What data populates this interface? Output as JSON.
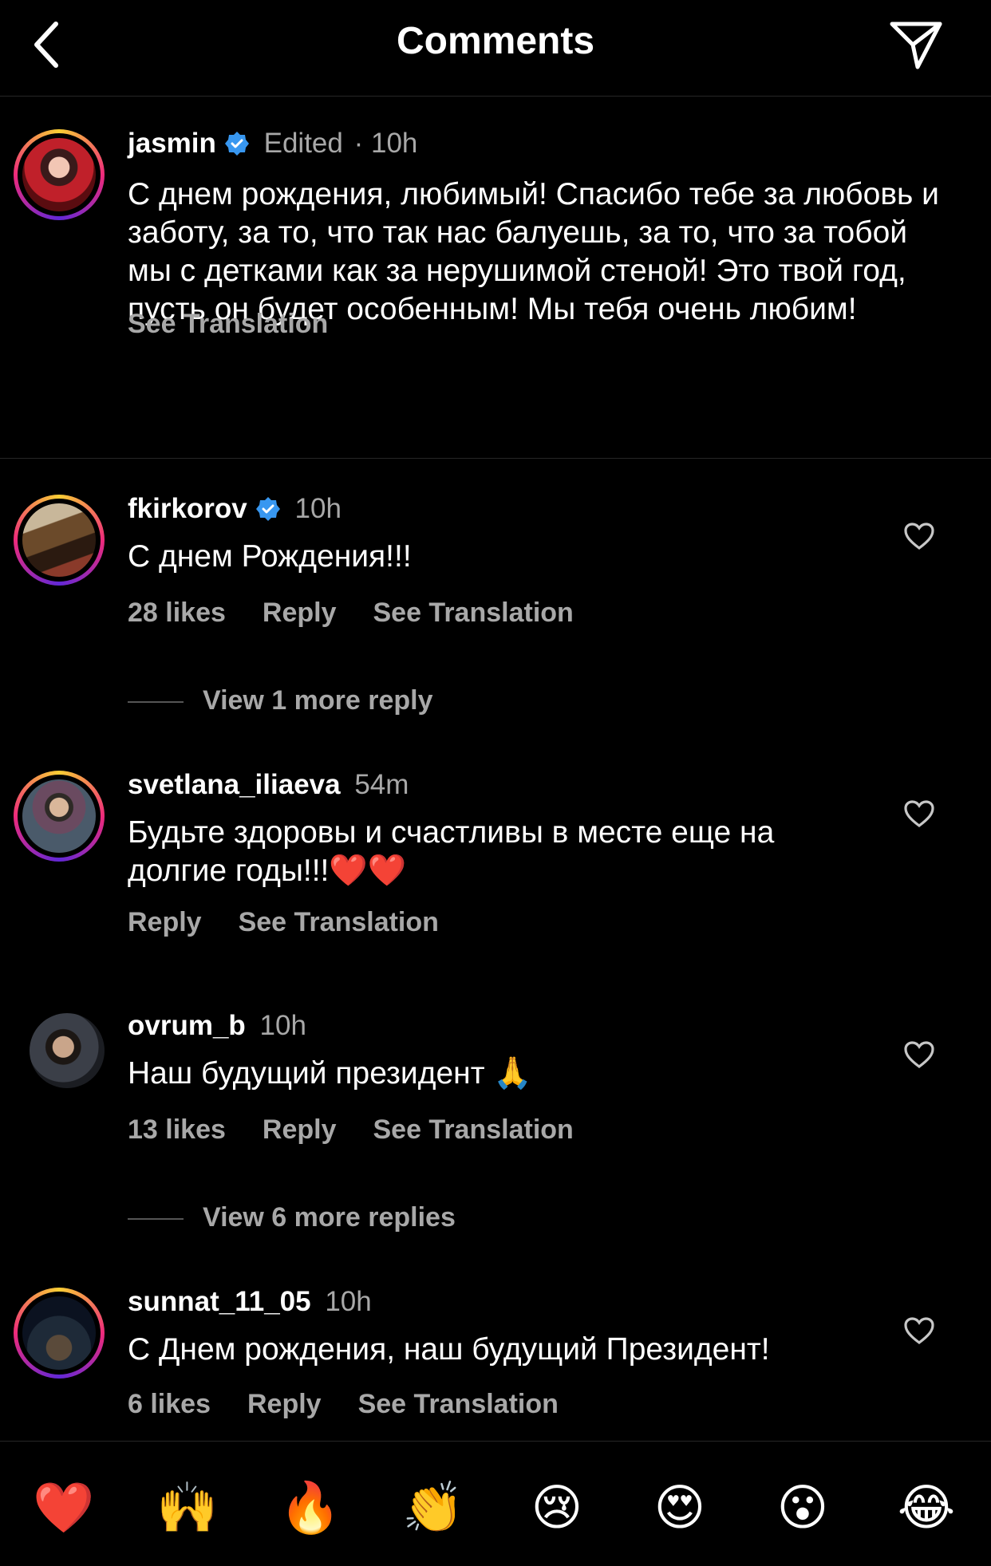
{
  "header": {
    "title": "Comments",
    "back_icon": "chevron-left-icon",
    "send_icon": "paper-plane-icon"
  },
  "caption": {
    "username": "jasmin",
    "edited": "Edited",
    "time": "· 10h",
    "text": "С днем рождения, любимый! Спасибо тебе за любовь и заботу, за то, что так нас балуешь, за то, что за тобой мы с детками как за нерушимой стеной! Это твой год, пусть он будет особенным! Мы тебя очень любим!",
    "see_translation": "See Translation"
  },
  "comments": [
    {
      "username": "fkirkorov",
      "time": "10h",
      "text": "С днем Рождения!!!",
      "likes": "28 likes",
      "reply": "Reply",
      "see_translation": "See Translation",
      "view_more": "View 1 more reply"
    },
    {
      "username": "svetlana_iliaeva",
      "time": "54m",
      "text": "Будьте здоровы и счастливы в месте еще на долгие годы!!!❤️❤️",
      "reply": "Reply",
      "see_translation": "See Translation"
    },
    {
      "username": "ovrum_b",
      "time": "10h",
      "text": "Наш будущий президент 🙏",
      "likes": "13 likes",
      "reply": "Reply",
      "see_translation": "See Translation",
      "view_more": "View 6 more replies"
    },
    {
      "username": "sunnat_11_05",
      "time": "10h",
      "text": "С Днем рождения, наш будущий Президент!",
      "likes": "6 likes",
      "reply": "Reply",
      "see_translation": "See Translation"
    }
  ],
  "emoji_bar": [
    "❤️",
    "🙌",
    "🔥",
    "👏",
    "😢",
    "😍",
    "😮",
    "😂"
  ],
  "colors": {
    "background": "#000000",
    "secondary_text": "#a8a8a8",
    "verified_blue": "#3897f0",
    "divider": "#262626"
  }
}
